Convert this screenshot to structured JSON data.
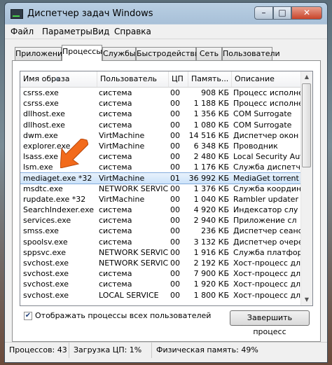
{
  "window": {
    "title": "Диспетчер задач Windows",
    "min": "–",
    "max": "□",
    "close": "✕"
  },
  "menu": [
    "Файл",
    "Параметры",
    "Вид",
    "Справка"
  ],
  "tabs": [
    "Приложения",
    "Процессы",
    "Службы",
    "Быстродействие",
    "Сеть",
    "Пользователи"
  ],
  "active_tab": "Процессы",
  "columns": [
    "Имя образа",
    "Пользователь",
    "ЦП",
    "Память...",
    "Описание"
  ],
  "processes": [
    {
      "name": "csrss.exe",
      "user": "система",
      "cpu": "00",
      "mem": "908 КБ",
      "desc": "Процесс исполне"
    },
    {
      "name": "csrss.exe",
      "user": "система",
      "cpu": "00",
      "mem": "1 188 КБ",
      "desc": "Процесс исполне"
    },
    {
      "name": "dllhost.exe",
      "user": "система",
      "cpu": "00",
      "mem": "1 356 КБ",
      "desc": "COM Surrogate"
    },
    {
      "name": "dllhost.exe",
      "user": "система",
      "cpu": "00",
      "mem": "1 080 КБ",
      "desc": "COM Surrogate"
    },
    {
      "name": "dwm.exe",
      "user": "VirtMachine",
      "cpu": "00",
      "mem": "14 516 КБ",
      "desc": "Диспетчер окон"
    },
    {
      "name": "explorer.exe",
      "user": "VirtMachine",
      "cpu": "00",
      "mem": "6 348 КБ",
      "desc": "Проводник"
    },
    {
      "name": "lsass.exe",
      "user": "система",
      "cpu": "00",
      "mem": "2 480 КБ",
      "desc": "Local Security Aut"
    },
    {
      "name": "lsm.exe",
      "user": "система",
      "cpu": "00",
      "mem": "1 176 КБ",
      "desc": "Служба диспетч"
    },
    {
      "name": "mediaget.exe *32",
      "user": "VirtMachine",
      "cpu": "01",
      "mem": "36 992 КБ",
      "desc": "MediaGet torrent"
    },
    {
      "name": "msdtc.exe",
      "user": "NETWORK SERVICE",
      "cpu": "00",
      "mem": "1 376 КБ",
      "desc": "Служба координ"
    },
    {
      "name": "rupdate.exe *32",
      "user": "VirtMachine",
      "cpu": "00",
      "mem": "1 040 КБ",
      "desc": "Rambler updater"
    },
    {
      "name": "SearchIndexer.exe",
      "user": "система",
      "cpu": "00",
      "mem": "4 920 КБ",
      "desc": "Индексатор слу"
    },
    {
      "name": "services.exe",
      "user": "система",
      "cpu": "00",
      "mem": "2 940 КБ",
      "desc": "Приложение сл"
    },
    {
      "name": "smss.exe",
      "user": "система",
      "cpu": "00",
      "mem": "236 КБ",
      "desc": "Диспетчер сеанс"
    },
    {
      "name": "spoolsv.exe",
      "user": "система",
      "cpu": "00",
      "mem": "3 132 КБ",
      "desc": "Диспетчер очере"
    },
    {
      "name": "sppsvc.exe",
      "user": "NETWORK SERVICE",
      "cpu": "00",
      "mem": "1 916 КБ",
      "desc": "Служба платфор"
    },
    {
      "name": "svchost.exe",
      "user": "NETWORK SERVICE",
      "cpu": "00",
      "mem": "2 192 КБ",
      "desc": "Хост-процесс дл"
    },
    {
      "name": "svchost.exe",
      "user": "система",
      "cpu": "00",
      "mem": "7 900 КБ",
      "desc": "Хост-процесс дл"
    },
    {
      "name": "svchost.exe",
      "user": "система",
      "cpu": "00",
      "mem": "1 920 КБ",
      "desc": "Хост-процесс дл"
    },
    {
      "name": "svchost.exe",
      "user": "LOCAL SERVICE",
      "cpu": "00",
      "mem": "1 800 КБ",
      "desc": "Хост-процесс дл"
    }
  ],
  "selected_process": "mediaget.exe *32",
  "show_all_users": {
    "label": "Отображать процессы всех пользователей",
    "checked": true
  },
  "end_process_button": "Завершить процесс",
  "status": {
    "processes": "Процессов: 43",
    "cpu": "Загрузка ЦП: 1%",
    "memory": "Физическая память: 49%"
  },
  "colors": {
    "selection": "#cce3f9",
    "annotation_arrow": "#f26a1b"
  }
}
